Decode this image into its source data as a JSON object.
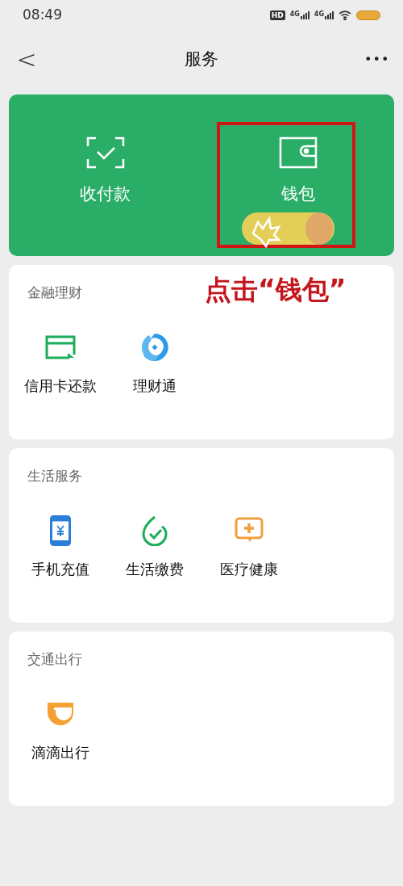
{
  "status_bar": {
    "time": "08:49",
    "badges": [
      "HD",
      "4G",
      "4G"
    ]
  },
  "nav": {
    "back": "<",
    "title": "服务",
    "more": "•••"
  },
  "wallet_card": {
    "items": [
      {
        "kind": "scan",
        "label": "收付款",
        "highlighted": false
      },
      {
        "kind": "wallet",
        "label": "钱包",
        "highlighted": true
      }
    ]
  },
  "annotation": {
    "text": "点击“钱包”"
  },
  "sections": [
    {
      "title": "金融理财",
      "items": [
        {
          "kind": "card",
          "label": "信用卡还款"
        },
        {
          "kind": "coin",
          "label": "理财通"
        }
      ]
    },
    {
      "title": "生活服务",
      "items": [
        {
          "kind": "phone",
          "label": "手机充值"
        },
        {
          "kind": "bill",
          "label": "生活缴费"
        },
        {
          "kind": "medical",
          "label": "医疗健康"
        }
      ]
    },
    {
      "title": "交通出行",
      "items": [
        {
          "kind": "ride",
          "label": "滴滴出行"
        }
      ]
    }
  ]
}
